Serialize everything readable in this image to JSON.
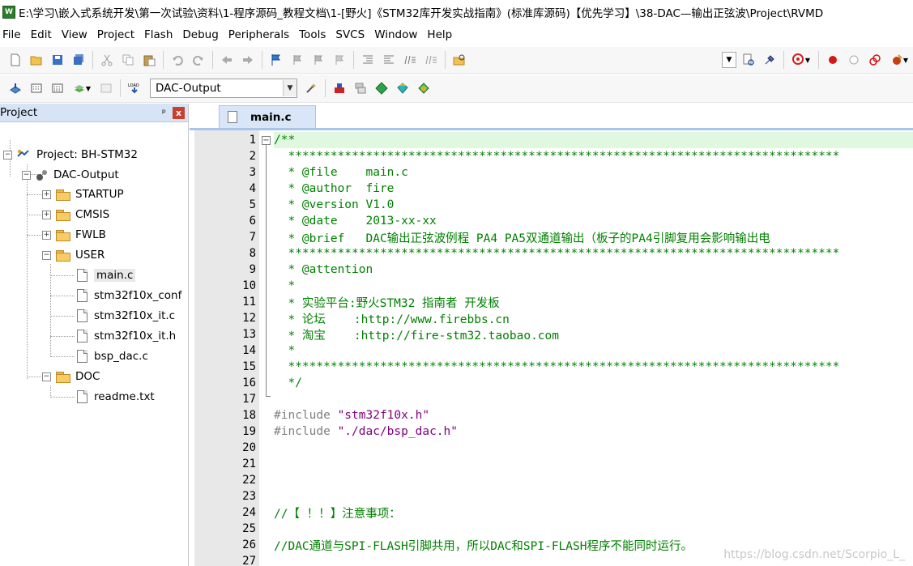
{
  "window": {
    "title": "E:\\学习\\嵌入式系统开发\\第一次试验\\资料\\1-程序源码_教程文档\\1-[野火]《STM32库开发实战指南》(标准库源码)【优先学习】\\38-DAC—输出正弦波\\Project\\RVMD",
    "app_icon": "keil-uvision-icon"
  },
  "menu": [
    "File",
    "Edit",
    "View",
    "Project",
    "Flash",
    "Debug",
    "Peripherals",
    "Tools",
    "SVCS",
    "Window",
    "Help"
  ],
  "toolbar": {
    "target": "DAC-Output"
  },
  "project_panel": {
    "title": "Project",
    "pin_glyph": "ᵖ",
    "close_glyph": "x",
    "tree": [
      {
        "label": "Project: BH-STM32"
      },
      {
        "label": "DAC-Output"
      },
      {
        "label": "STARTUP"
      },
      {
        "label": "CMSIS"
      },
      {
        "label": "FWLB"
      },
      {
        "label": "USER"
      },
      {
        "label": "main.c"
      },
      {
        "label": "stm32f10x_conf"
      },
      {
        "label": "stm32f10x_it.c"
      },
      {
        "label": "stm32f10x_it.h"
      },
      {
        "label": "bsp_dac.c"
      },
      {
        "label": "DOC"
      },
      {
        "label": "readme.txt"
      }
    ]
  },
  "editor": {
    "tab": "main.c",
    "lines": [
      "/**",
      "  ******************************************************************************",
      "  * @file    main.c",
      "  * @author  fire",
      "  * @version V1.0",
      "  * @date    2013-xx-xx",
      "  * @brief   DAC输出正弦波例程 PA4 PA5双通道输出（板子的PA4引脚复用会影响输出电",
      "  ******************************************************************************",
      "  * @attention",
      "  *",
      "  * 实验平台:野火STM32 指南者 开发板",
      "  * 论坛    :http://www.firebbs.cn",
      "  * 淘宝    :http://fire-stm32.taobao.com",
      "  *",
      "  ******************************************************************************",
      "  */",
      "",
      "#include \"stm32f10x.h\"",
      "#include \"./dac/bsp_dac.h\"",
      "",
      "",
      "",
      "",
      "//【 ！！】注意事项：",
      "",
      "//DAC通道与SPI-FLASH引脚共用，所以DAC和SPI-FLASH程序不能同时运行。",
      ""
    ],
    "line_numbers": [
      "1",
      "2",
      "3",
      "4",
      "5",
      "6",
      "7",
      "8",
      "9",
      "10",
      "11",
      "12",
      "13",
      "14",
      "15",
      "16",
      "17",
      "18",
      "19",
      "20",
      "21",
      "22",
      "23",
      "24",
      "25",
      "26",
      "27"
    ],
    "include_directive": "#include",
    "include_1": "\"stm32f10x.h\"",
    "include_2": "\"./dac/bsp_dac.h\""
  },
  "watermark": "https://blog.csdn.net/Scorpio_L_"
}
